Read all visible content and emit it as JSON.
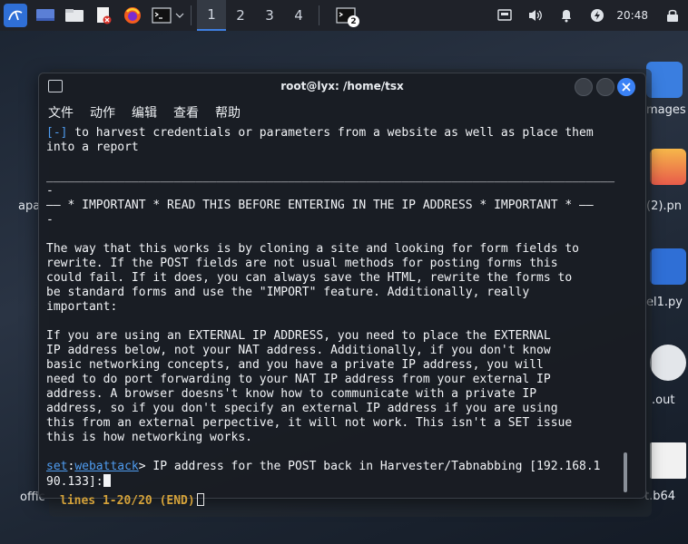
{
  "panel": {
    "workspaces": [
      "1",
      "2",
      "3",
      "4"
    ],
    "terminal_badge": "2",
    "clock": "20:48"
  },
  "desktop": {
    "labels": {
      "images": "mages",
      "png": "(2).pn",
      "py": "el1.py",
      "out": ".out",
      "b64": "t.b64",
      "apa": "apa",
      "offic": "offic"
    }
  },
  "window": {
    "title": "root@lyx: /home/tsx",
    "menu": [
      "文件",
      "动作",
      "编辑",
      "查看",
      "帮助"
    ]
  },
  "terminal": {
    "line1_tag": "[-]",
    "line1_text": " to harvest credentials or parameters from a website as well as place them",
    "line2": "into a report",
    "rule": "________________________________________________________________________________\n-",
    "important": "—— * IMPORTANT * READ THIS BEFORE ENTERING IN THE IP ADDRESS * IMPORTANT * ——\n-",
    "para1": "The way that this works is by cloning a site and looking for form fields to\nrewrite. If the POST fields are not usual methods for posting forms this\ncould fail. If it does, you can always save the HTML, rewrite the forms to\nbe standard forms and use the \"IMPORT\" feature. Additionally, really\nimportant:",
    "para2": "If you are using an EXTERNAL IP ADDRESS, you need to place the EXTERNAL\nIP address below, not your NAT address. Additionally, if you don't know\nbasic networking concepts, and you have a private IP address, you will\nneed to do port forwarding to your NAT IP address from your external IP\naddress. A browser doesns't know how to communicate with a private IP\naddress, so if you don't specify an external IP address if you are using\nthis from an external perpective, it will not work. This isn't a SET issue\nthis is how networking works.",
    "prompt_set": "set",
    "prompt_colon": ":",
    "prompt_module": "webattack",
    "prompt_text": "> IP address for the POST back in Harvester/Tabnabbing [192.168.1\n90.133]:"
  },
  "background_terminal": {
    "status": "lines 1-20/20 (END)"
  }
}
